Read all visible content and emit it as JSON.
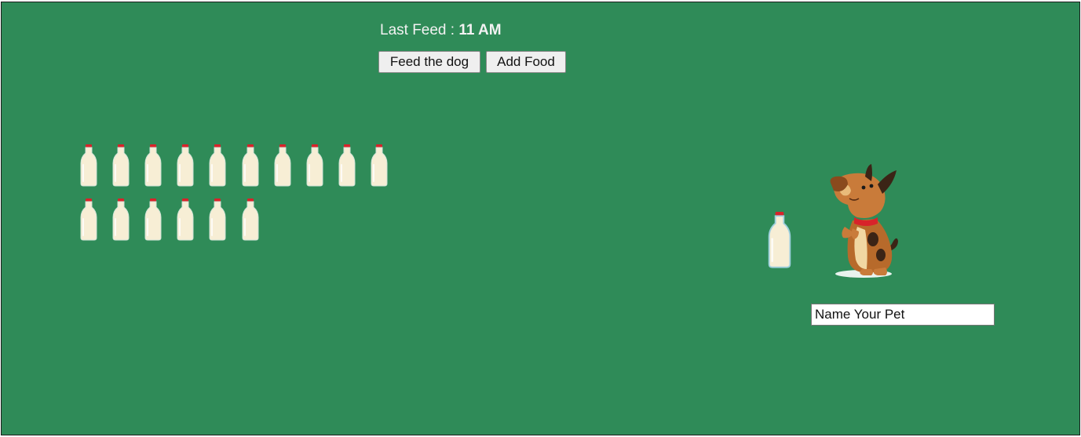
{
  "header": {
    "last_feed_label": "Last Feed : ",
    "last_feed_time": "11 AM"
  },
  "buttons": {
    "feed": "Feed the dog",
    "add": "Add Food"
  },
  "food_stock": {
    "count": 16,
    "icon": "milk-bottle-icon"
  },
  "pet": {
    "icon": "dog-icon",
    "name_placeholder": "Name Your Pet"
  },
  "colors": {
    "background": "#2f8b58",
    "bottle_cap": "#d8232a",
    "bottle_milk": "#f7eed5"
  }
}
